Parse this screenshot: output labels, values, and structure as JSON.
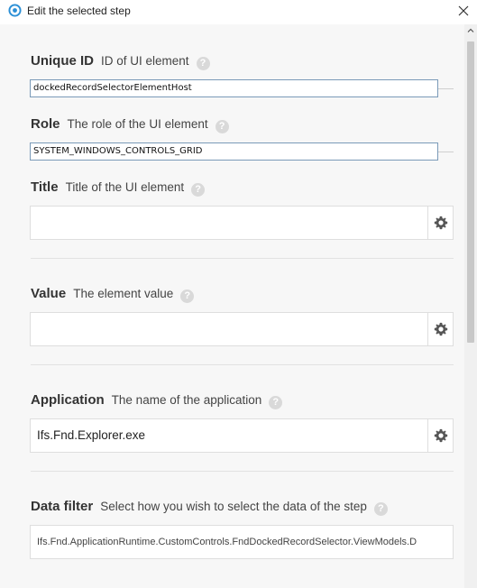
{
  "window": {
    "title": "Edit the selected step"
  },
  "fields": {
    "unique_id": {
      "label": "Unique ID",
      "description": "ID of UI element",
      "value": "dockedRecordSelectorElementHost"
    },
    "role": {
      "label": "Role",
      "description": "The role of the UI element",
      "value": "SYSTEM_WINDOWS_CONTROLS_GRID"
    },
    "title": {
      "label": "Title",
      "description": "Title of the UI element",
      "value": ""
    },
    "value": {
      "label": "Value",
      "description": "The element value",
      "value": ""
    },
    "application": {
      "label": "Application",
      "description": "The name of the application",
      "value": "Ifs.Fnd.Explorer.exe"
    },
    "data_filter": {
      "label": "Data filter",
      "description": "Select how you wish to select the data of the step",
      "value": "Ifs.Fnd.ApplicationRuntime.CustomControls.FndDockedRecordSelector.ViewModels.D"
    }
  },
  "help_glyph": "?",
  "colors": {
    "accent": "#2b8fd6",
    "label": "#333333",
    "input_border": "#7a9ab8",
    "panel_bg": "#f7f7f7"
  },
  "icons": {
    "app": "target-icon",
    "close": "close-icon",
    "settings": "gear-icon",
    "help": "help-icon"
  }
}
